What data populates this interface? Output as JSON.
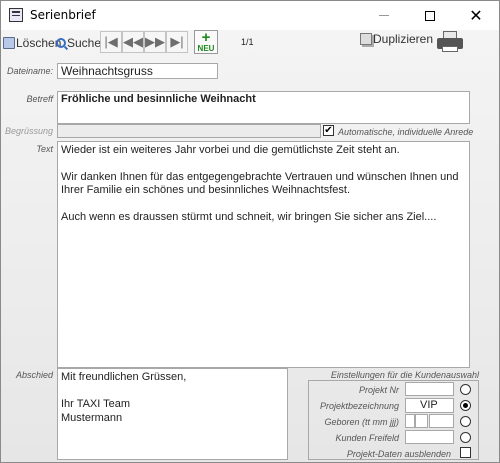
{
  "window": {
    "title": "Serienbrief"
  },
  "toolbar": {
    "delete_label": "Löschen",
    "search_label": "Suche",
    "new_label": "NEU",
    "pager": "1/1",
    "duplicate_label": "Duplizieren"
  },
  "form": {
    "dateiname_label": "Dateiname:",
    "dateiname_value": "Weihnachtsgruss",
    "betreff_label": "Betreff",
    "betreff_value": "Fröhliche und besinnliche Weihnacht",
    "begruessung_label": "Begrüssung",
    "begruessung_value": "",
    "auto_anrede_label": "Automatische, individuelle Anrede",
    "auto_anrede_checked": true,
    "text_label": "Text",
    "text_paragraphs": [
      "Wieder ist ein weiteres Jahr vorbei und die gemütlichste Zeit steht an.",
      "Wir danken Ihnen für das entgegengebrachte Vertrauen und wünschen Ihnen und Ihrer Familie ein schönes und besinnliches  Weihnachtsfest.",
      "Auch wenn es draussen stürmt und schneit, wir bringen Sie sicher ans Ziel...."
    ],
    "abschied_label": "Abschied",
    "abschied_lines": [
      "Mit freundlichen Grüssen,",
      "",
      "Ihr TAXI Team",
      "Mustermann"
    ]
  },
  "filter": {
    "title": "Einstellungen für die Kundenauswahl",
    "projekt_nr_label": "Projekt Nr",
    "projekt_nr_value": "",
    "projektbez_label": "Projektbezeichnung",
    "projektbez_value": "VIP",
    "geboren_label": "Geboren (tt mm jjj)",
    "kunden_freifeld_label": "Kunden Freifeld",
    "kunden_freifeld_value": "",
    "ausblenden_label": "Projekt-Daten ausblenden",
    "selected_option": "Projektbezeichnung"
  }
}
